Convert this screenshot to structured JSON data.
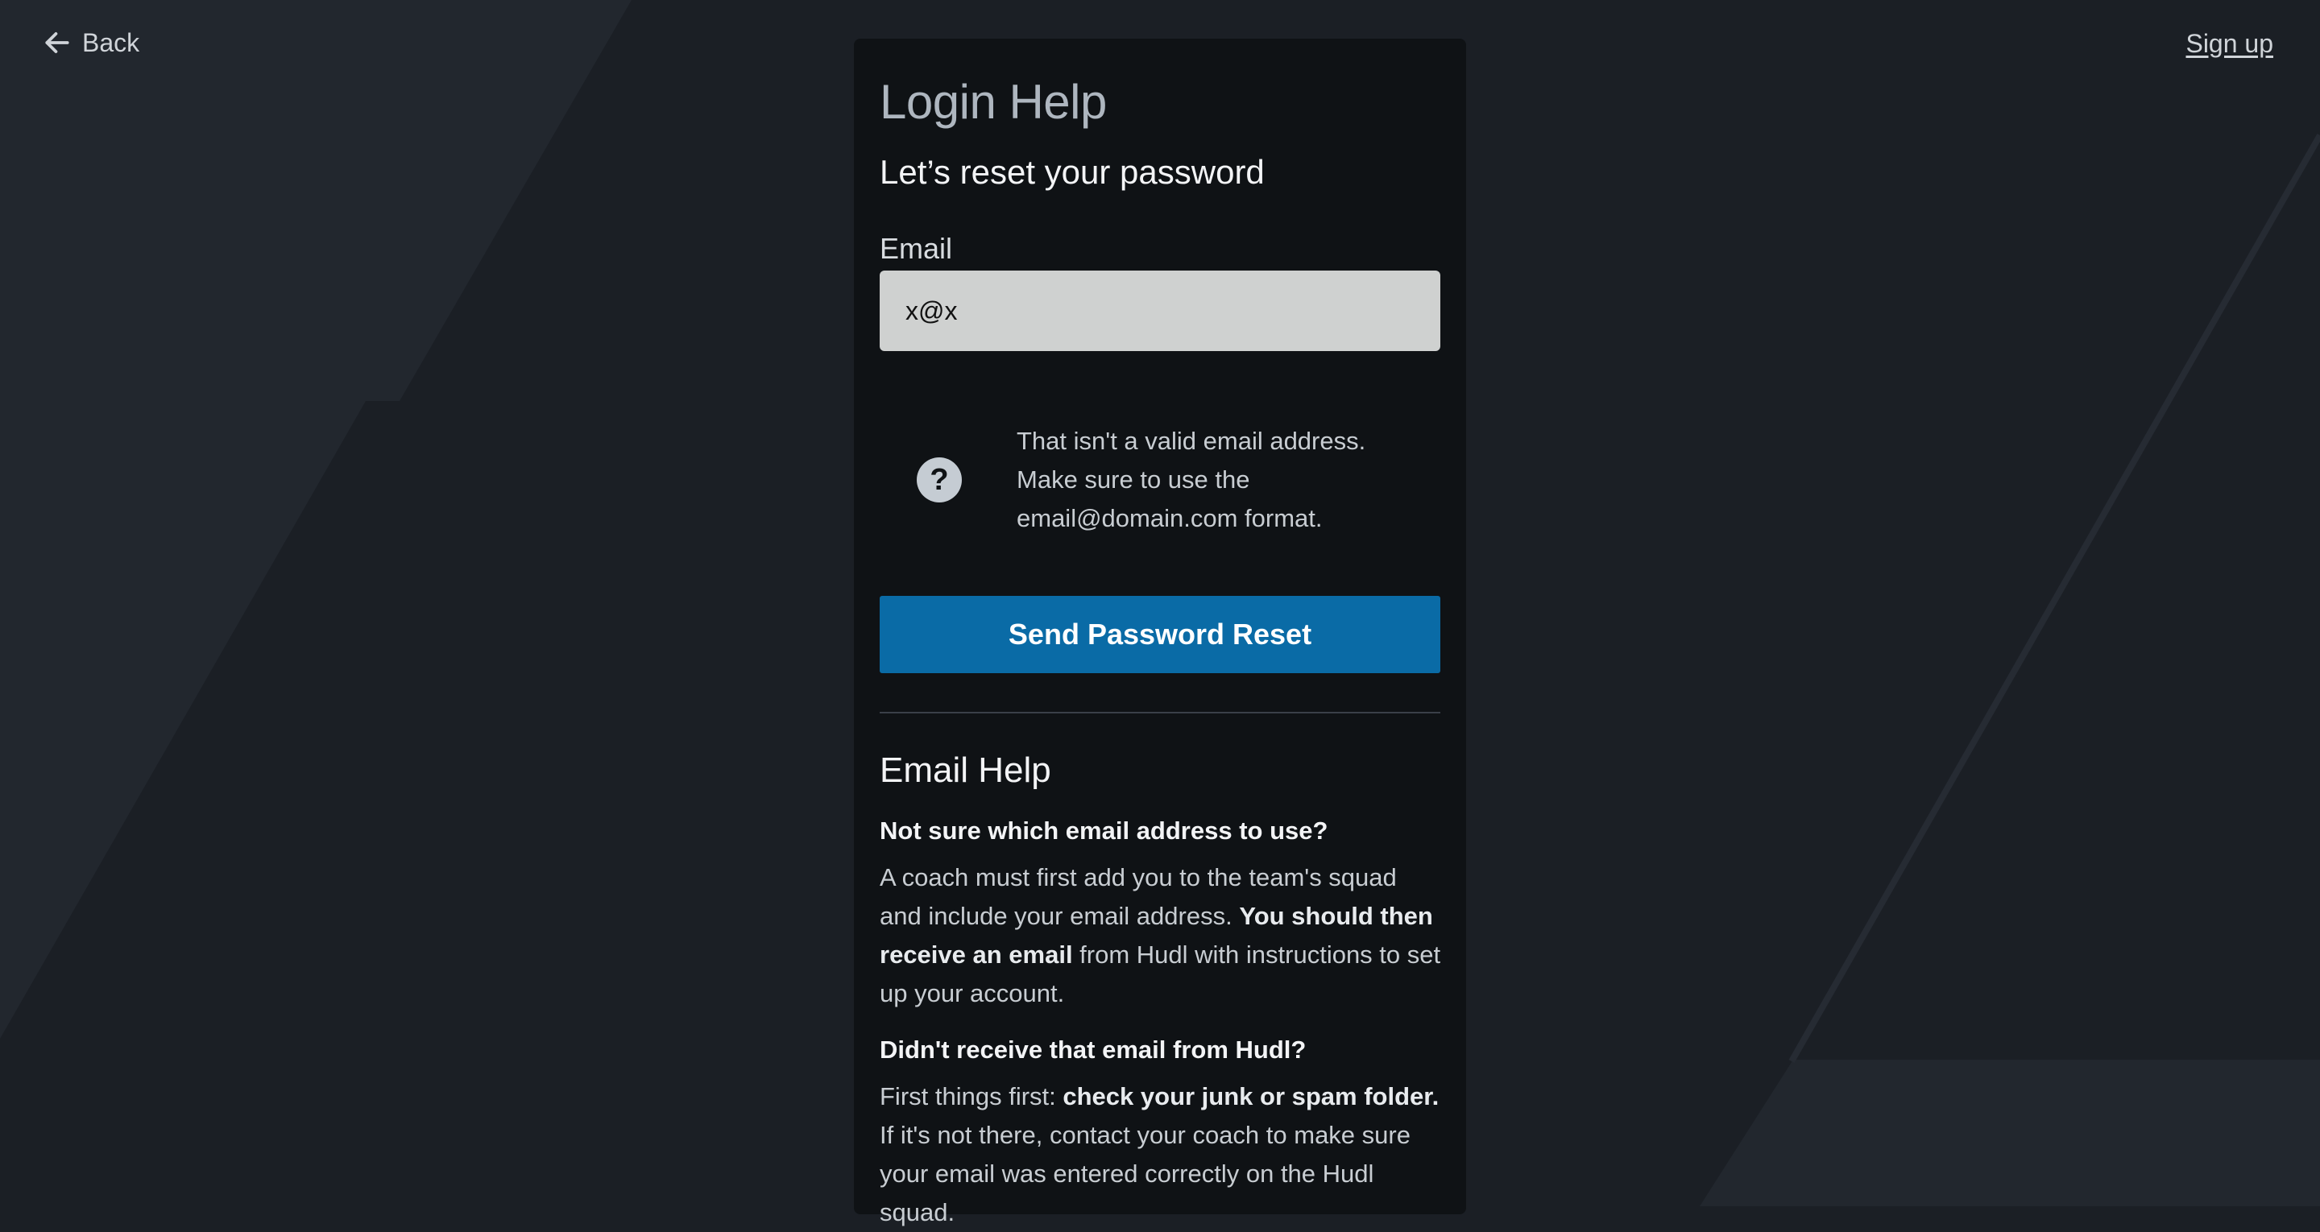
{
  "nav": {
    "back_label": "Back",
    "signup_label": "Sign up"
  },
  "card": {
    "title": "Login Help",
    "subtitle": "Let’s reset your password",
    "email_label": "Email",
    "email_value": "x@x",
    "error": {
      "icon": "question-icon",
      "icon_glyph": "?",
      "line1": "That isn't a valid email address.",
      "line2": "Make sure to use the",
      "line3": "email@domain.com format."
    },
    "submit_label": "Send Password Reset"
  },
  "help": {
    "title": "Email Help",
    "q1": "Not sure which email address to use?",
    "a1": {
      "part1": "A coach must first add you to the team's squad and include your email address. ",
      "bold": "You should then receive an email",
      "part2": " from Hudl with instructions to set up your account."
    },
    "q2": "Didn't receive that email from Hudl?",
    "a2": {
      "part1": "First things first: ",
      "bold": "check your junk or spam folder.",
      "part2": " If it's not there, contact your coach to make sure your email was entered correctly on the Hudl squad."
    }
  },
  "colors": {
    "background": "#1b1f25",
    "card": "#0f1215",
    "primary": "#0a6ba6",
    "input": "#cfd1d0"
  }
}
